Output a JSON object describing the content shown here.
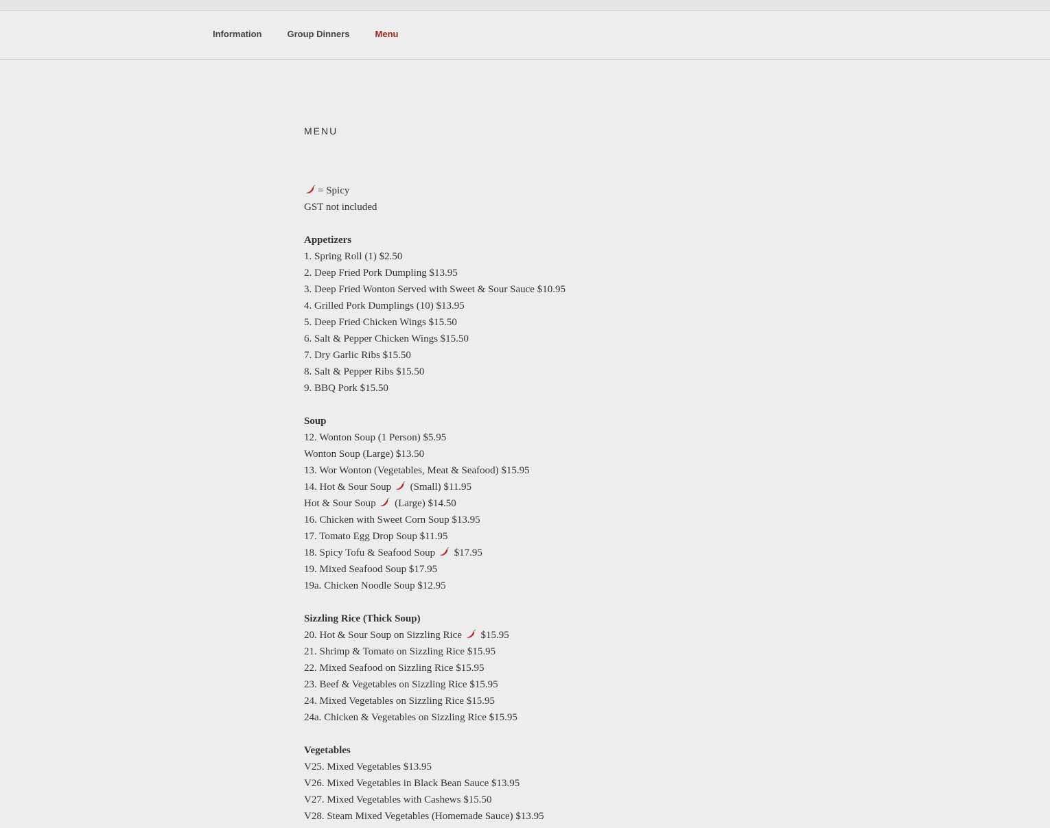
{
  "nav": {
    "items": [
      {
        "label": "Information"
      },
      {
        "label": "Group Dinners"
      },
      {
        "label": "Menu"
      }
    ],
    "active_color": "#a0281c"
  },
  "page": {
    "title": "Menu"
  },
  "legend": {
    "spicy": "= Spicy",
    "tax_note": "GST not included"
  },
  "sections": [
    {
      "heading": "Appetizers",
      "items": [
        {
          "pre": "1. Spring Roll (1) $2.50"
        },
        {
          "pre": "2. Deep Fried Pork Dumpling $13.95"
        },
        {
          "pre": "3. Deep Fried Wonton Served with Sweet & Sour Sauce $10.95"
        },
        {
          "pre": "4. Grilled Pork Dumplings (10) $13.95"
        },
        {
          "pre": "5. Deep Fried Chicken Wings $15.50"
        },
        {
          "pre": "6. Salt & Pepper Chicken Wings $15.50"
        },
        {
          "pre": "7. Dry Garlic Ribs $15.50"
        },
        {
          "pre": "8. Salt & Pepper Ribs $15.50"
        },
        {
          "pre": "9. BBQ Pork $15.50"
        }
      ]
    },
    {
      "heading": "Soup",
      "items": [
        {
          "pre": "12. Wonton Soup (1 Person) $5.95"
        },
        {
          "pre": "Wonton Soup (Large) $13.50"
        },
        {
          "pre": "13. Wor Wonton (Vegetables, Meat & Seafood) $15.95"
        },
        {
          "pre": "14. Hot & Sour Soup",
          "post": "(Small) $11.95",
          "spicy": true
        },
        {
          "pre": "Hot & Sour Soup",
          "post": "(Large) $14.50",
          "spicy": true
        },
        {
          "pre": "16. Chicken with Sweet Corn Soup $13.95"
        },
        {
          "pre": "17. Tomato Egg Drop Soup $11.95"
        },
        {
          "pre": "18. Spicy Tofu & Seafood Soup",
          "post": "$17.95",
          "spicy": true
        },
        {
          "pre": "19. Mixed Seafood Soup $17.95"
        },
        {
          "pre": "19a. Chicken Noodle Soup $12.95"
        }
      ]
    },
    {
      "heading": "Sizzling Rice (Thick Soup)",
      "items": [
        {
          "pre": "20. Hot & Sour Soup on Sizzling Rice",
          "post": "$15.95",
          "spicy": true
        },
        {
          "pre": "21. Shrimp & Tomato on Sizzling Rice $15.95"
        },
        {
          "pre": "22. Mixed Seafood on Sizzling Rice $15.95"
        },
        {
          "pre": "23. Beef & Vegetables on Sizzling Rice $15.95"
        },
        {
          "pre": "24. Mixed Vegetables on Sizzling Rice $15.95"
        },
        {
          "pre": "24a. Chicken & Vegetables on Sizzling Rice $15.95"
        }
      ]
    },
    {
      "heading": "Vegetables",
      "items": [
        {
          "pre": "V25. Mixed Vegetables $13.95"
        },
        {
          "pre": "V26. Mixed Vegetables in Black Bean Sauce $13.95"
        },
        {
          "pre": "V27. Mixed Vegetables with Cashews $15.50"
        },
        {
          "pre": "V28. Steam Mixed Vegetables (Homemade Sauce) $13.95"
        }
      ]
    }
  ],
  "icons": {
    "spicy": "chili-pepper-icon"
  },
  "colors": {
    "background": "#ededed",
    "text": "#333333",
    "chili": "#c0262e"
  }
}
